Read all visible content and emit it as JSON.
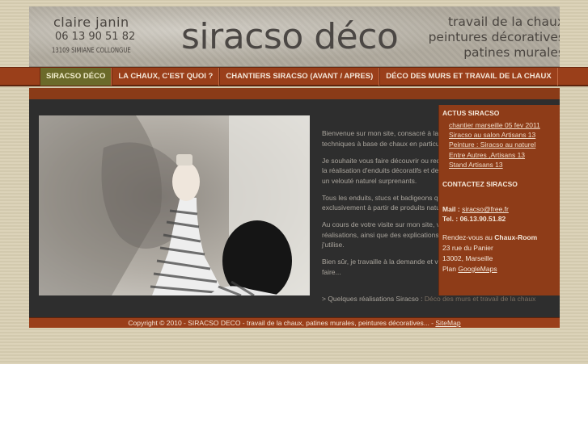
{
  "header": {
    "contact_name": "claire   janin",
    "contact_phone": "06 13 90 51 82",
    "contact_city": "13109 SIMIANE COLLONGUE",
    "site_title": "siracso déco",
    "tagline": [
      "travail de la chaux",
      "peintures décoratives",
      "patines murales"
    ]
  },
  "nav": {
    "items": [
      {
        "label": "SIRACSO DÉCO",
        "active": true
      },
      {
        "label": "LA CHAUX, C'EST QUOI ?",
        "active": false
      },
      {
        "label": "CHANTIERS SIRACSO (AVANT / APRES)",
        "active": false
      },
      {
        "label": "DÉCO DES MURS ET TRAVAIL DE LA CHAUX",
        "active": false
      }
    ]
  },
  "intro": {
    "paragraphs": [
      "Bienvenue sur mon site, consacré à la décoration des murs en général, et des techniques à base de chaux en particulier.",
      "Je souhaite vous faire découvrir ou redécouvrir ce matériau naturel, permettant la réalisation d'enduits décoratifs et de patines avec des effets de profondeur et un velouté naturel surprenants.",
      "Tous les enduits, stucs et badigeons que j'utilise sont fabriqués par mes soins exclusivement à partir de produits naturels.",
      "Au cours de votre visite sur mon site, vous pourrez découvrir certaines de mes réalisations, ainsi que des explications sur les différentes techniques que j'utilise.",
      "Bien sûr, je travaille à la demande et vous propose d'intervenir par mon savoir-faire..."
    ],
    "more_prefix": "> Quelques réalisations Siracso :",
    "more_link": "Déco des murs et travail de la chaux"
  },
  "sidebar": {
    "news_heading": "ACTUS SIRACSO",
    "news_links": [
      "chantier marseille 05 fev 2011",
      "Siracso au salon Artisans 13",
      "Peinture : Siracso au naturel",
      "Entre Autres ,Artisans 13",
      "Stand Artisans 13"
    ],
    "contact_heading": "CONTACTEZ SIRACSO",
    "mail_label": "Mail :",
    "mail_value": "siracso@free.fr",
    "tel": "Tel. : 06.13.90.51.82",
    "meet_prefix": "Rendez-vous au",
    "meet_place": "Chaux-Room",
    "address": [
      "23 rue du Panier",
      "13002, Marseille"
    ],
    "plan_label": "Plan",
    "plan_link": "GoogleMaps"
  },
  "footer": {
    "text": "Copyright © 2010 - SIRACSO DECO - travail de la chaux, patines murales, peintures décoratives... -",
    "sitemap": "SiteMap"
  },
  "colors": {
    "nav_bg": "#9a3f1a",
    "nav_active": "#6b6a2a",
    "main_bg": "#2e2e2e",
    "page_bg": "#d9cfb3"
  }
}
